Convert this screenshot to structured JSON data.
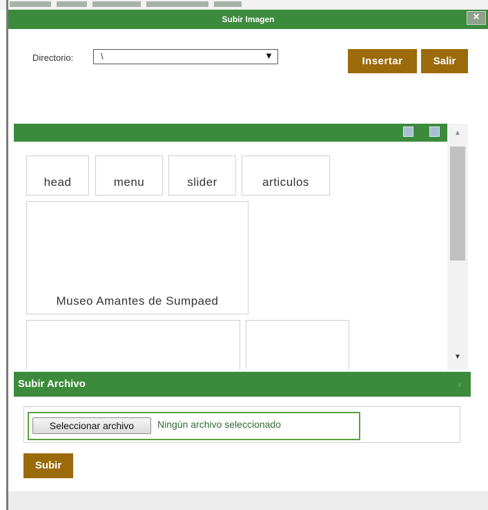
{
  "dialog": {
    "title": "Subir Imagen",
    "close_icon": "close-icon",
    "close_glyph": "×"
  },
  "toolbar": {
    "directory_label": "Directorio:",
    "directory_value": "\\",
    "insert_label": "Insertar",
    "exit_label": "Salir"
  },
  "gallery": {
    "view_icons": [
      "list-view-icon",
      "grid-view-icon"
    ],
    "items": [
      "head",
      "menu",
      "slider",
      "articulos",
      "Museo Amantes de Sumpaed",
      "",
      ""
    ]
  },
  "upload": {
    "section_title": "Subir Archivo",
    "choose_file_label": "Seleccionar archivo",
    "no_file_text": "Ningún archivo seleccionado",
    "submit_label": "Subir"
  },
  "colors": {
    "header_green": "#3c8a3c",
    "button_brown": "#9b6a0a"
  }
}
